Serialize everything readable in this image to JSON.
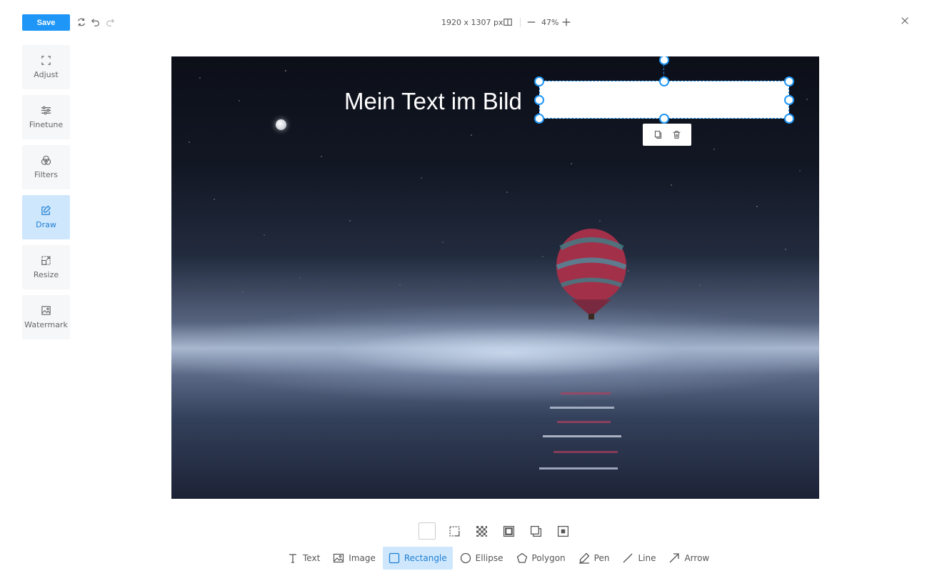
{
  "toolbar": {
    "save_label": "Save",
    "dimensions": "1920 x 1307 px",
    "zoom": "47%"
  },
  "sidebar": {
    "items": [
      {
        "label": "Adjust",
        "icon": "crop-icon"
      },
      {
        "label": "Finetune",
        "icon": "sliders-icon"
      },
      {
        "label": "Filters",
        "icon": "filters-icon"
      },
      {
        "label": "Draw",
        "icon": "draw-icon",
        "active": true
      },
      {
        "label": "Resize",
        "icon": "resize-icon"
      },
      {
        "label": "Watermark",
        "icon": "watermark-icon"
      }
    ]
  },
  "canvas": {
    "text": "Mein Text im Bild"
  },
  "style_options": [
    {
      "name": "fill-color-swatch"
    },
    {
      "name": "stroke-style-icon"
    },
    {
      "name": "opacity-icon"
    },
    {
      "name": "stroke-width-icon"
    },
    {
      "name": "shadow-icon"
    },
    {
      "name": "padding-icon"
    }
  ],
  "tools": [
    {
      "label": "Text",
      "icon": "text-tool-icon"
    },
    {
      "label": "Image",
      "icon": "image-tool-icon"
    },
    {
      "label": "Rectangle",
      "icon": "rectangle-tool-icon",
      "active": true
    },
    {
      "label": "Ellipse",
      "icon": "ellipse-tool-icon"
    },
    {
      "label": "Polygon",
      "icon": "polygon-tool-icon"
    },
    {
      "label": "Pen",
      "icon": "pen-tool-icon"
    },
    {
      "label": "Line",
      "icon": "line-tool-icon"
    },
    {
      "label": "Arrow",
      "icon": "arrow-tool-icon"
    }
  ],
  "colors": {
    "accent": "#1e96f7",
    "active_bg": "#cfe7fd"
  }
}
